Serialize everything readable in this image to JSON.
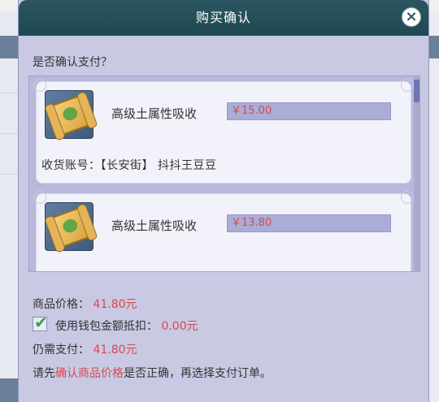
{
  "dialog": {
    "title": "购买确认",
    "prompt": "是否确认支付？"
  },
  "items": [
    {
      "name": "高级土属性吸收",
      "price": "￥15.00",
      "account_label": "收货账号：",
      "account_value": "【长安街】 抖抖王豆豆",
      "icon": "talisman-scroll-icon"
    },
    {
      "name": "高级土属性吸收",
      "price": "￥13.80",
      "icon": "talisman-scroll-icon"
    }
  ],
  "summary": {
    "goods_price_label": "商品价格：",
    "goods_price_value": "41.80元",
    "wallet_label": "使用钱包金额抵扣：",
    "wallet_value": "0.00元",
    "wallet_checked": true,
    "due_label": "仍需支付：",
    "due_value": "41.80元"
  },
  "hint": {
    "prefix": "请先",
    "highlight": "确认商品价格",
    "suffix": "是否正确，再选择支付订单。"
  },
  "colors": {
    "titlebar": "#245058",
    "price_red": "#d9474d",
    "dialog_bg": "#c9c9e4"
  }
}
